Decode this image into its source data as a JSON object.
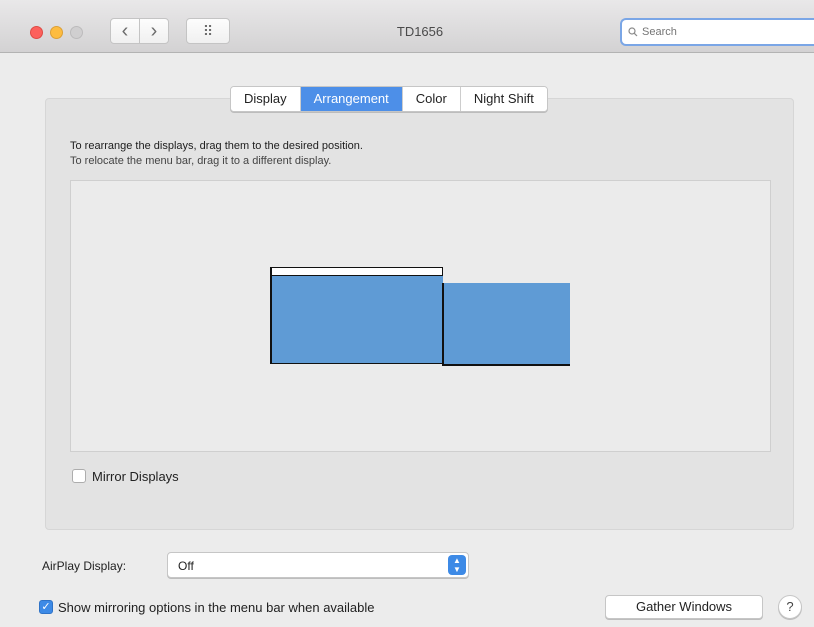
{
  "window": {
    "title": "TD1656",
    "search_placeholder": "Search"
  },
  "toolbar": {
    "back_icon": "‹",
    "forward_icon": "›",
    "grid_icon": "⠿"
  },
  "tabs": [
    {
      "label": "Display",
      "active": false
    },
    {
      "label": "Arrangement",
      "active": true
    },
    {
      "label": "Color",
      "active": false
    },
    {
      "label": "Night Shift",
      "active": false
    }
  ],
  "arrangement": {
    "instruction_primary": "To rearrange the displays, drag them to the desired position.",
    "instruction_secondary": "To relocate the menu bar, drag it to a different display.",
    "display_color": "#5f9bd5"
  },
  "mirror_displays": {
    "label": "Mirror Displays",
    "checked": false
  },
  "airplay": {
    "label": "AirPlay Display:",
    "value": "Off"
  },
  "show_mirroring": {
    "label": "Show mirroring options in the menu bar when available",
    "checked": true
  },
  "buttons": {
    "gather_windows": "Gather Windows",
    "help": "?"
  },
  "colors": {
    "accent": "#3d8ae6",
    "tab_active": "#4d8fe8"
  }
}
